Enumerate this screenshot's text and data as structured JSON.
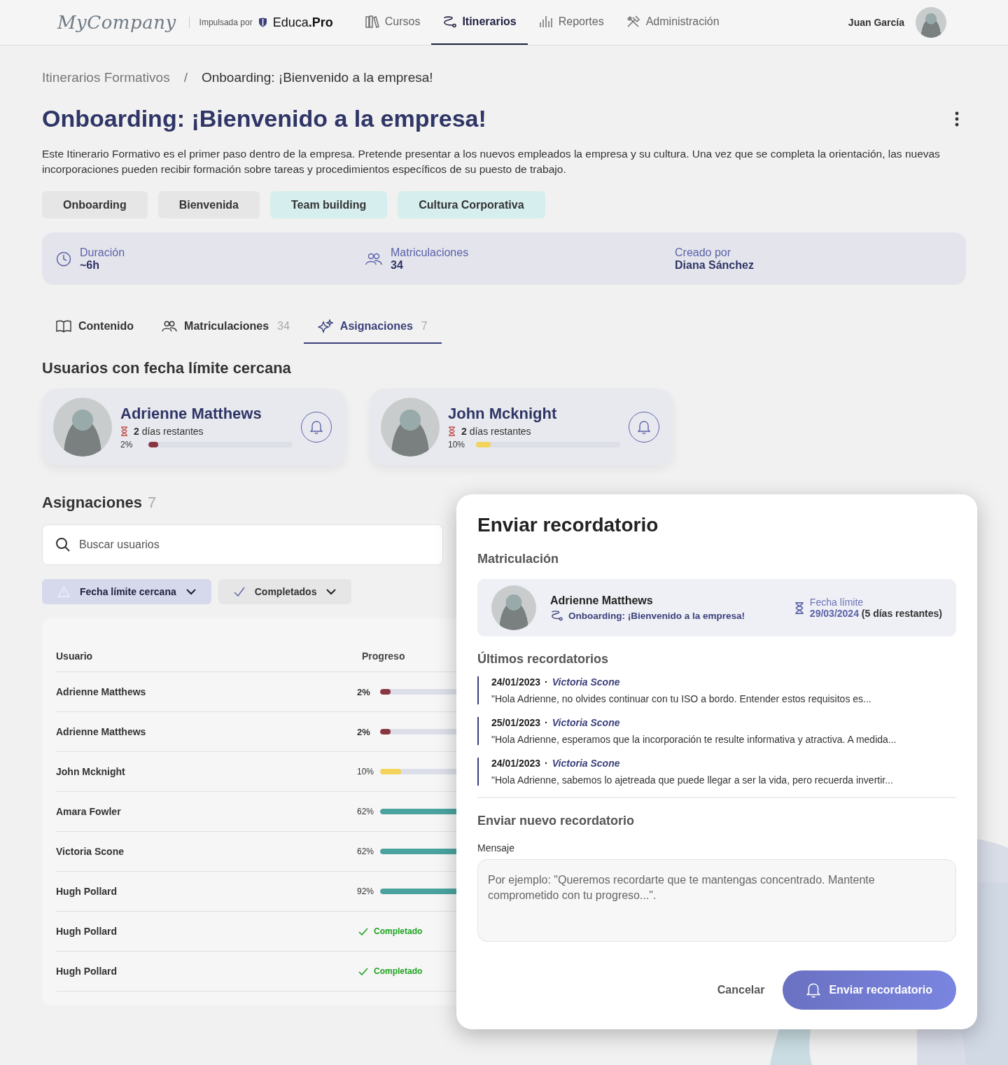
{
  "header": {
    "logo": "MyCompany",
    "powered_by": "Impulsada por",
    "brand_name": "Educa",
    "brand_suffix": ".Pro",
    "nav": [
      {
        "label": "Cursos",
        "selected": false
      },
      {
        "label": "Itinerarios",
        "selected": true
      },
      {
        "label": "Reportes",
        "selected": false
      },
      {
        "label": "Administración",
        "selected": false
      }
    ],
    "user": {
      "name": "Juan García"
    }
  },
  "breadcrumb": {
    "items": [
      "Itinerarios Formativos",
      "Onboarding: ¡Bienvenido a la empresa!"
    ],
    "separator": "/"
  },
  "title": "Onboarding: ¡Bienvenido a la empresa!",
  "description": "Este Itinerario Formativo es el primer paso dentro de la empresa. Pretende presentar a los nuevos empleados la empresa y su cultura. Una vez que se completa la orientación, las nuevas incorporaciones pueden recibir formación sobre tareas y procedimientos específicos de su puesto de trabajo.",
  "tags": [
    {
      "label": "Onboarding",
      "color": "#e6e6e6"
    },
    {
      "label": "Bienvenida",
      "color": "#e6e6e6"
    },
    {
      "label": "Team building",
      "color": "#d6eeee"
    },
    {
      "label": "Cultura Corporativa",
      "color": "#d6eeee"
    }
  ],
  "stats": [
    {
      "label": "Duración",
      "value": "~6h"
    },
    {
      "label": "Matriculaciones",
      "value": "34"
    },
    {
      "label": "Creado por",
      "value": "Diana Sánchez"
    }
  ],
  "tabs": [
    {
      "label": "Contenido",
      "selected": false
    },
    {
      "label": "Matriculaciones",
      "count": "34",
      "selected": false
    },
    {
      "label": "Asignaciones",
      "count": "7",
      "selected": true
    }
  ],
  "upcoming": {
    "title": "Usuarios con fecha límite cercana",
    "users": [
      {
        "name": "Adrienne Matthews",
        "remaining": "**2** días restantes",
        "percent": "2%",
        "level": 0.02
      },
      {
        "name": "John Mcknight",
        "remaining": "**2** días restantes",
        "percent": "10%",
        "level": 0.1
      }
    ]
  },
  "assignments": {
    "title": "Asignaciones",
    "count": "7",
    "search": {
      "placeholder": "Buscar usuarios"
    },
    "filters": [
      {
        "label": "Fecha límite cercana",
        "selected": true
      },
      {
        "label": "Completados",
        "selected": false
      }
    ],
    "columns": [
      "Usuario",
      "Progreso"
    ],
    "rows": [
      {
        "user": "Adrienne Matthews",
        "kind": "percent",
        "percent": "2%",
        "level": 0.02,
        "urgent": true
      },
      {
        "user": "Adrienne Matthews",
        "kind": "percent",
        "percent": "2%",
        "level": 0.02,
        "urgent": true
      },
      {
        "user": "John Mcknight",
        "kind": "percent",
        "percent": "10%",
        "level": 0.1,
        "urgent": false
      },
      {
        "user": "Amara Fowler",
        "kind": "percent",
        "percent": "62%",
        "level": 0.62,
        "urgent": false
      },
      {
        "user": "Victoria Scone",
        "kind": "percent",
        "percent": "62%",
        "level": 0.62,
        "urgent": false
      },
      {
        "user": "Hugh Pollard",
        "kind": "percent",
        "percent": "92%",
        "level": 0.92,
        "urgent": false
      },
      {
        "user": "Hugh Pollard",
        "kind": "completed",
        "status": "Completado"
      },
      {
        "user": "Hugh Pollard",
        "kind": "completed",
        "status": "Completado"
      }
    ]
  },
  "modal": {
    "title": "Enviar recordatorio",
    "section": "Matriculación",
    "enrollment": {
      "name": "Adrienne Matthews",
      "path": "Onboarding: ¡Bienvenido a la empresa!",
      "deadline_label": "Fecha límite",
      "deadline_date": "29/03/2024",
      "deadline_remaining": "(5 días restantes)"
    },
    "recent_title": "Últimos recordatorios",
    "reminder_separator": "·",
    "reminders": [
      {
        "date": "24/01/2023",
        "author": "Victoria Scone",
        "message": "\"Hola Adrienne, no olvides continuar con tu ISO a bordo. Entender estos requisitos es..."
      },
      {
        "date": "25/01/2023",
        "author": "Victoria Scone",
        "message": "\"Hola Adrienne, esperamos que la incorporación te resulte informativa y atractiva. A medida..."
      },
      {
        "date": "24/01/2023",
        "author": "Victoria Scone",
        "message": "\"Hola Adrienne, sabemos lo ajetreada que puede llegar a ser la vida, pero recuerda invertir..."
      }
    ],
    "new_title": "Enviar nuevo recordatorio",
    "message_label": "Mensaje",
    "message_placeholder": "Por ejemplo: \"Queremos recordarte que te mantengas concentrado. Mantente comprometido con tu progreso...\".",
    "cancel": "Cancelar",
    "submit": "Enviar recordatorio"
  }
}
